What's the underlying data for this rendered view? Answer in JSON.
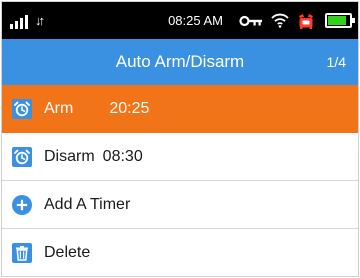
{
  "status_bar": {
    "data_arrows": "↓↑",
    "time": "08:25 AM",
    "battery_level": 0.85,
    "icons": [
      "signal-icon",
      "data-transfer-icon",
      "key-icon",
      "wifi-icon",
      "alarm-clock-icon",
      "battery-icon"
    ]
  },
  "header": {
    "title": "Auto Arm/Disarm",
    "page_indicator": "1/4"
  },
  "menu": {
    "items": [
      {
        "label": "Arm",
        "time": "20:25",
        "icon": "alarm-clock-icon",
        "selected": true
      },
      {
        "label": "Disarm",
        "time": "08:30",
        "icon": "alarm-clock-icon",
        "selected": false
      },
      {
        "label": "Add A Timer",
        "icon": "plus-circle-icon",
        "selected": false
      },
      {
        "label": "Delete",
        "icon": "trash-icon",
        "selected": false
      }
    ]
  },
  "colors": {
    "status_bar_bg": "#000000",
    "header_bg": "#3a91e2",
    "selected_row_bg": "#f27418",
    "icon_blue": "#3a91e2",
    "battery_green": "#34d11c",
    "alarm_red": "#ff3b30"
  }
}
